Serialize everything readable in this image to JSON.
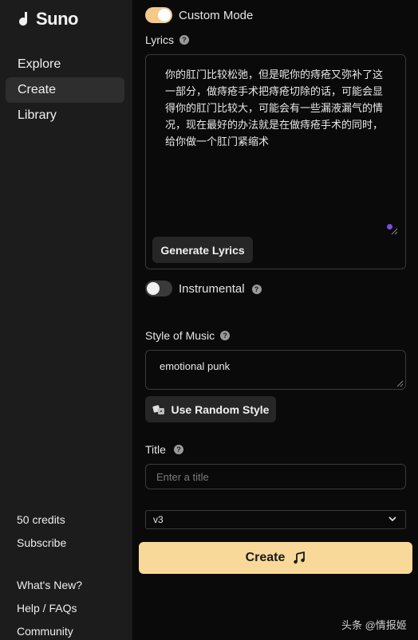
{
  "brand": {
    "name": "Suno"
  },
  "nav": {
    "items": [
      {
        "label": "Explore"
      },
      {
        "label": "Create"
      },
      {
        "label": "Library"
      }
    ]
  },
  "sidebar_footer": {
    "credits": "50 credits",
    "subscribe": "Subscribe",
    "whats_new": "What's New?",
    "help": "Help / FAQs",
    "community": "Community"
  },
  "form": {
    "custom_mode": {
      "label": "Custom Mode",
      "on": true
    },
    "lyrics": {
      "label": "Lyrics",
      "value": "你的肛门比较松弛，但是呢你的痔疮又弥补了这一部分，做痔疮手术把痔疮切除的话，可能会显得你的肛门比较大，可能会有一些漏液漏气的情况，现在最好的办法就是在做痔疮手术的同时，给你做一个肛门紧缩术",
      "generate_button": "Generate Lyrics"
    },
    "instrumental": {
      "label": "Instrumental",
      "on": false
    },
    "style": {
      "label": "Style of Music",
      "value": "emotional punk",
      "random_button": "Use Random Style"
    },
    "title": {
      "label": "Title",
      "placeholder": "Enter a title"
    },
    "model": {
      "selected": "v3"
    },
    "create_button": "Create"
  },
  "watermark": "头条 @情报姬",
  "colors": {
    "accent": "#f9d99a",
    "toggle_on": "#f4c98a",
    "sidebar_bg": "#1c1c1c",
    "purple_dot": "#7b4de0"
  }
}
